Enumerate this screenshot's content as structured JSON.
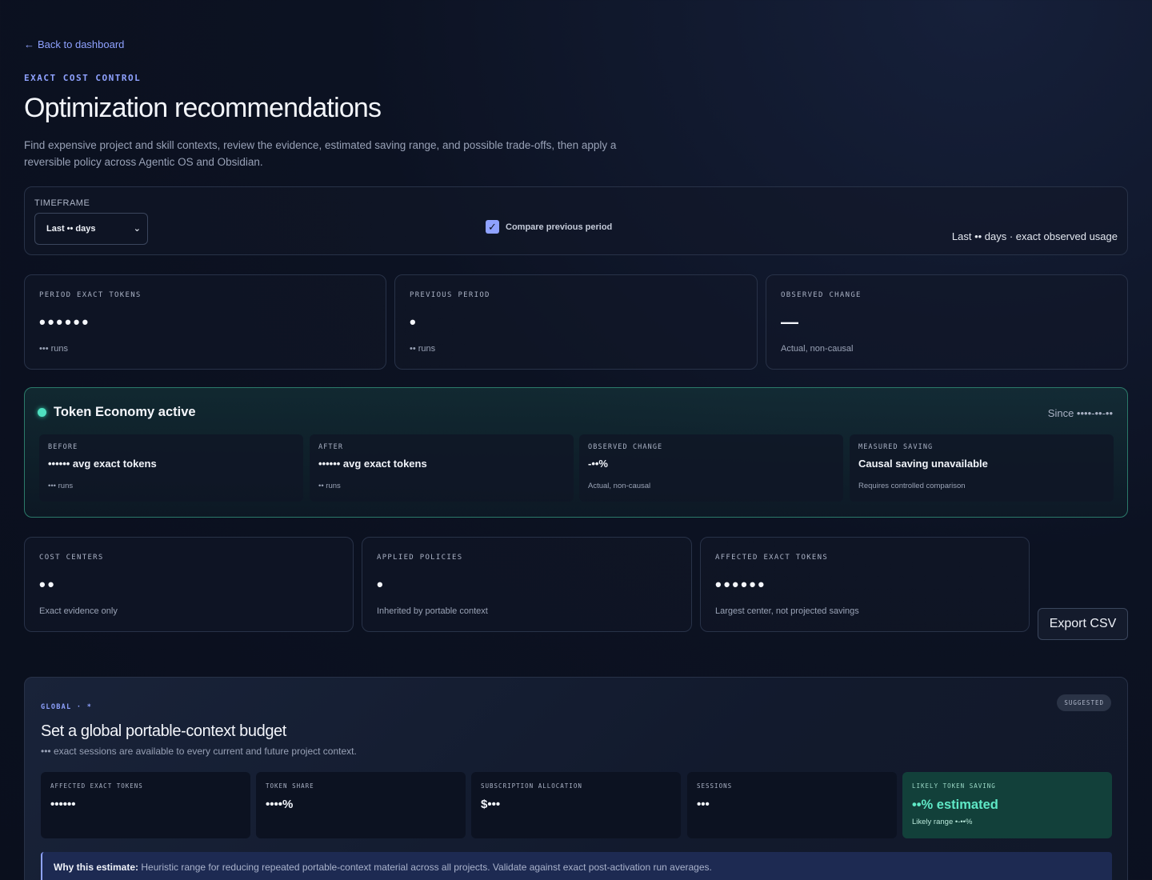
{
  "nav": {
    "back_label": "Back to dashboard"
  },
  "header": {
    "eyebrow": "EXACT COST CONTROL",
    "title": "Optimization recommendations",
    "subtitle": "Find expensive project and skill contexts, review the evidence, estimated saving range, and possible trade-offs, then apply a reversible policy across Agentic OS and Obsidian."
  },
  "timeframe": {
    "label": "TIMEFRAME",
    "selected": "Last •• days",
    "compare_label": "Compare previous period",
    "compare_checked": true,
    "summary": "Last •• days · exact observed usage"
  },
  "period_stats": [
    {
      "label": "Period exact tokens",
      "value": "••••••",
      "sub": "••• runs"
    },
    {
      "label": "Previous period",
      "value": "•",
      "sub": "•• runs"
    },
    {
      "label": "Observed change",
      "value": "—",
      "sub": "Actual, non-causal"
    }
  ],
  "token_economy": {
    "title": "Token Economy active",
    "since": "Since ••••-••-••",
    "cards": [
      {
        "label": "Before",
        "value": "•••••• avg exact tokens",
        "sub": "••• runs"
      },
      {
        "label": "After",
        "value": "•••••• avg exact tokens",
        "sub": "•• runs"
      },
      {
        "label": "Observed change",
        "value": "-••%",
        "sub": "Actual, non-causal"
      },
      {
        "label": "Measured saving",
        "value": "Causal saving unavailable",
        "sub": "Requires controlled comparison"
      }
    ]
  },
  "cost_stats": [
    {
      "label": "Cost centers",
      "value": "••",
      "sub": "Exact evidence only"
    },
    {
      "label": "Applied policies",
      "value": "•",
      "sub": "Inherited by portable context"
    },
    {
      "label": "Affected exact tokens",
      "value": "••••••",
      "sub": "Largest center, not projected savings"
    }
  ],
  "export_label": "Export CSV",
  "recommendation": {
    "scope": "Global · *",
    "badge": "SUGGESTED",
    "title": "Set a global portable-context budget",
    "description": "••• exact sessions are available to every current and future project context.",
    "cards": [
      {
        "label": "Affected exact tokens",
        "value": "••••••"
      },
      {
        "label": "Token share",
        "value": "••••%"
      },
      {
        "label": "Subscription allocation",
        "value": "$•••"
      },
      {
        "label": "Sessions",
        "value": "•••"
      },
      {
        "label": "Likely token saving",
        "value": "••% estimated",
        "sub": "Likely range •-••%"
      }
    ],
    "why_label": "Why this estimate:",
    "why_text": "Heuristic range for reducing repeated portable-context material across all projects. Validate against exact post-activation run averages."
  },
  "colors": {
    "accent": "#8fa2ff",
    "active": "#4fe0c0",
    "saving": "#5fe8c6"
  }
}
